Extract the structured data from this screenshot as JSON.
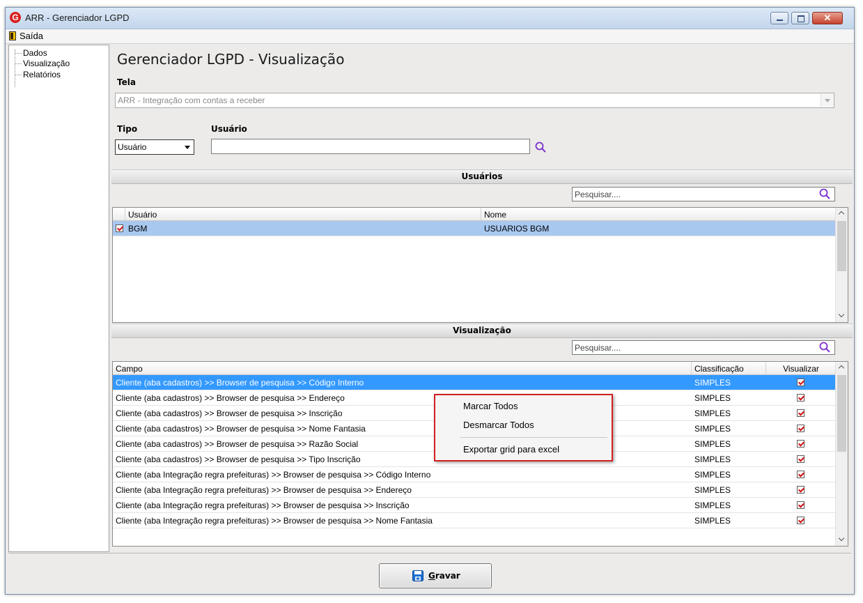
{
  "window": {
    "title": "ARR - Gerenciador LGPD",
    "logo_letter": "G"
  },
  "menu": {
    "exit_label": "Saída"
  },
  "tree": {
    "items": [
      "Dados",
      "Visualização",
      "Relatórios"
    ]
  },
  "page_title": "Gerenciador LGPD - Visualização",
  "tela": {
    "label": "Tela",
    "value": "ARR - Integração com contas a receber"
  },
  "tipo": {
    "label": "Tipo",
    "value": "Usuário"
  },
  "usuario": {
    "label": "Usuário",
    "value": ""
  },
  "usuarios_section": {
    "title": "Usuários",
    "search_placeholder": "Pesquisar....",
    "columns": [
      "Usuário",
      "Nome"
    ],
    "rows": [
      {
        "usuario": "BGM",
        "nome": "USUARIOS BGM",
        "checked": true
      }
    ]
  },
  "visualizacao_section": {
    "title": "Visualização",
    "search_placeholder": "Pesquisar....",
    "columns": [
      "Campo",
      "Classificação",
      "Visualizar"
    ],
    "rows": [
      {
        "campo": "Cliente (aba cadastros) >> Browser de pesquisa >> Código Interno",
        "classificacao": "SIMPLES",
        "visualizar": true
      },
      {
        "campo": "Cliente (aba cadastros) >> Browser de pesquisa >> Endereço",
        "classificacao": "SIMPLES",
        "visualizar": true
      },
      {
        "campo": "Cliente (aba cadastros) >> Browser de pesquisa >> Inscrição",
        "classificacao": "SIMPLES",
        "visualizar": true
      },
      {
        "campo": "Cliente (aba cadastros) >> Browser de pesquisa >> Nome Fantasia",
        "classificacao": "SIMPLES",
        "visualizar": true
      },
      {
        "campo": "Cliente (aba cadastros) >> Browser de pesquisa >> Razão Social",
        "classificacao": "SIMPLES",
        "visualizar": true
      },
      {
        "campo": "Cliente (aba cadastros) >> Browser de pesquisa >> Tipo Inscrição",
        "classificacao": "SIMPLES",
        "visualizar": true
      },
      {
        "campo": "Cliente (aba Integração regra prefeituras) >> Browser de pesquisa >> Código Interno",
        "classificacao": "SIMPLES",
        "visualizar": true
      },
      {
        "campo": "Cliente (aba Integração regra prefeituras) >> Browser de pesquisa >> Endereço",
        "classificacao": "SIMPLES",
        "visualizar": true
      },
      {
        "campo": "Cliente (aba Integração regra prefeituras) >> Browser de pesquisa >> Inscrição",
        "classificacao": "SIMPLES",
        "visualizar": true
      },
      {
        "campo": "Cliente (aba Integração regra prefeituras) >> Browser de pesquisa >> Nome Fantasia",
        "classificacao": "SIMPLES",
        "visualizar": true
      }
    ]
  },
  "context_menu": {
    "items": [
      "Marcar Todos",
      "Desmarcar Todos",
      "Exportar grid para excel"
    ]
  },
  "save_button": {
    "label": "Gravar"
  },
  "colors": {
    "selection": "#3399ff",
    "selection_unfocused": "#a8c8f0",
    "accent_red": "#d11f1f",
    "search_icon": "#7b2fd0"
  }
}
